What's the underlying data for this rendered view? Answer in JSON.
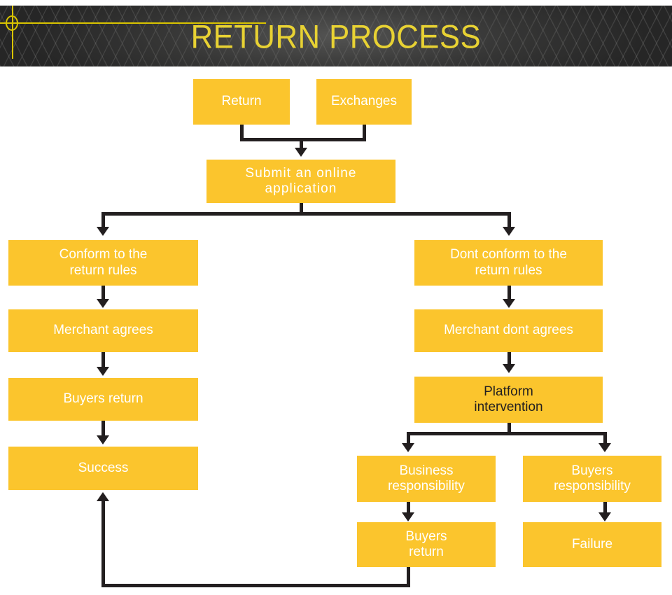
{
  "header": {
    "title": "RETURN PROCESS",
    "background_color": "#262626",
    "title_color": "#E8D233",
    "accent_color": "#D9C400",
    "decoration": "crosshair-target"
  },
  "theme": {
    "node_fill": "#FBC52D",
    "node_text": "#FFFFFF",
    "node_text_alt": "#231F20",
    "connector_color": "#231F20",
    "canvas_background": "#FFFFFF"
  },
  "flow": {
    "nodes": [
      {
        "id": "return",
        "label": "Return",
        "text_style": "light"
      },
      {
        "id": "exchanges",
        "label": "Exchanges",
        "text_style": "light"
      },
      {
        "id": "submit-application",
        "label": "Submit an online\napplication",
        "text_style": "light"
      },
      {
        "id": "conform-rules",
        "label": "Conform to the\nreturn rules",
        "text_style": "light"
      },
      {
        "id": "dont-conform-rules",
        "label": "Dont conform to the\nreturn rules",
        "text_style": "light"
      },
      {
        "id": "merchant-agrees",
        "label": "Merchant agrees",
        "text_style": "light"
      },
      {
        "id": "merchant-dont-agrees",
        "label": "Merchant dont agrees",
        "text_style": "light"
      },
      {
        "id": "buyers-return-left",
        "label": "Buyers return",
        "text_style": "light"
      },
      {
        "id": "platform-intervention",
        "label": "Platform\nintervention",
        "text_style": "dark"
      },
      {
        "id": "success",
        "label": "Success",
        "text_style": "light"
      },
      {
        "id": "business-responsibility",
        "label": "Business\nresponsibility",
        "text_style": "light"
      },
      {
        "id": "buyers-responsibility",
        "label": "Buyers\nresponsibility",
        "text_style": "light"
      },
      {
        "id": "buyers-return-bottom",
        "label": "Buyers\nreturn",
        "text_style": "light"
      },
      {
        "id": "failure",
        "label": "Failure",
        "text_style": "light"
      }
    ],
    "edges": [
      {
        "from": "return",
        "to": "submit-application"
      },
      {
        "from": "exchanges",
        "to": "submit-application"
      },
      {
        "from": "submit-application",
        "to": "conform-rules"
      },
      {
        "from": "submit-application",
        "to": "dont-conform-rules"
      },
      {
        "from": "conform-rules",
        "to": "merchant-agrees"
      },
      {
        "from": "merchant-agrees",
        "to": "buyers-return-left"
      },
      {
        "from": "buyers-return-left",
        "to": "success"
      },
      {
        "from": "dont-conform-rules",
        "to": "merchant-dont-agrees"
      },
      {
        "from": "merchant-dont-agrees",
        "to": "platform-intervention"
      },
      {
        "from": "platform-intervention",
        "to": "business-responsibility"
      },
      {
        "from": "platform-intervention",
        "to": "buyers-responsibility"
      },
      {
        "from": "business-responsibility",
        "to": "buyers-return-bottom"
      },
      {
        "from": "buyers-responsibility",
        "to": "failure"
      },
      {
        "from": "buyers-return-bottom",
        "to": "success"
      }
    ]
  }
}
